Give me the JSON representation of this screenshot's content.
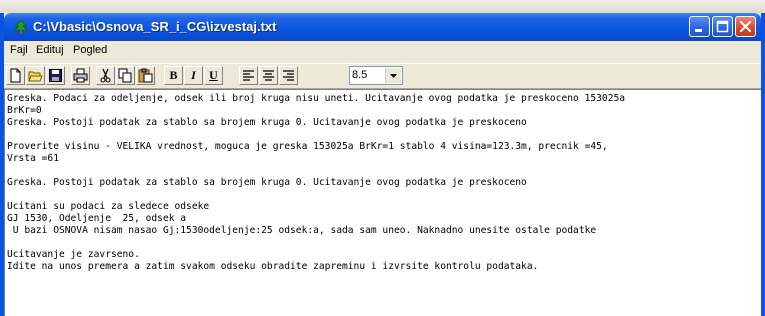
{
  "window": {
    "title": "C:\\Vbasic\\Osnova_SR_i_CG\\izvestaj.txt",
    "title_icon": "tree-icon",
    "accent": "#0a54e4"
  },
  "menu": {
    "items": [
      "Fajl",
      "Edituj",
      "Pogled"
    ]
  },
  "toolbar": {
    "bold_label": "B",
    "italic_label": "I",
    "underline_label": "U",
    "font_size": "8.5"
  },
  "document": {
    "lines": [
      "Greska. Podaci za odeljenje, odsek ili broj kruga nisu uneti. Ucitavanje ovog podatka je preskoceno 153025a",
      "BrKr=0",
      "Greska. Postoji podatak za stablo sa brojem kruga 0. Ucitavanje ovog podatka je preskoceno",
      "",
      "Proverite visinu - VELIKA vrednost, moguca je greska 153025a BrKr=1 stablo 4 visina=123.3m, precnik =45,",
      "Vrsta =61",
      "",
      "Greska. Postoji podatak za stablo sa brojem kruga 0. Ucitavanje ovog podatka je preskoceno",
      "",
      "Ucitani su podaci za sledece odseke",
      "GJ 1530, Odeljenje  25, odsek a",
      " U bazi OSNOVA nisam nasao Gj:1530odeljenje:25 odsek:a, sada sam uneo. Naknadno unesite ostale podatke",
      "",
      "Ucitavanje je zavrseno.",
      "Idite na unos premera a zatim svakom odseku obradite zapreminu i izvrsite kontrolu podataka."
    ]
  }
}
